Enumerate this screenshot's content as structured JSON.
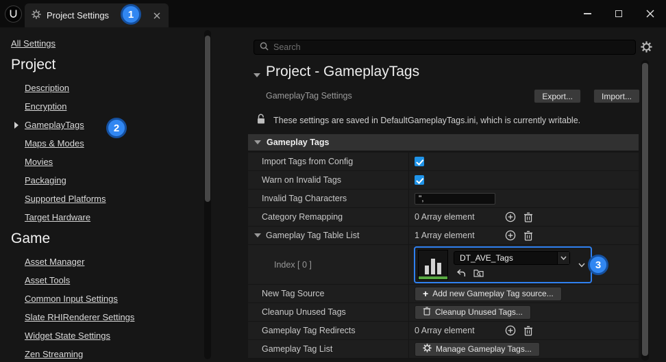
{
  "window": {
    "tab_title": "Project Settings"
  },
  "annotations": {
    "one": "1",
    "two": "2",
    "three": "3"
  },
  "sidebar": {
    "all_settings": "All Settings",
    "selected": "GameplayTags",
    "sections": [
      {
        "title": "Project",
        "items": [
          "Description",
          "Encryption",
          "GameplayTags",
          "Maps & Modes",
          "Movies",
          "Packaging",
          "Supported Platforms",
          "Target Hardware"
        ]
      },
      {
        "title": "Game",
        "items": [
          "Asset Manager",
          "Asset Tools",
          "Common Input Settings",
          "Slate RHIRenderer Settings",
          "Widget State Settings",
          "Zen Streaming"
        ]
      }
    ]
  },
  "search": {
    "placeholder": "Search"
  },
  "page": {
    "title": "Project - GameplayTags",
    "subtitle": "GameplayTag Settings",
    "export_button": "Export...",
    "import_button": "Import...",
    "notice": "These settings are saved in DefaultGameplayTags.ini, which is currently writable."
  },
  "section": {
    "title": "Gameplay Tags"
  },
  "rows": {
    "import_tags_from_config": {
      "label": "Import Tags from Config",
      "checked": true
    },
    "warn_on_invalid_tags": {
      "label": "Warn on Invalid Tags",
      "checked": true
    },
    "invalid_tag_characters": {
      "label": "Invalid Tag Characters",
      "value": "\","
    },
    "category_remapping": {
      "label": "Category Remapping",
      "value": "0 Array element"
    },
    "gameplay_tag_table_list": {
      "label": "Gameplay Tag Table List",
      "value": "1 Array element"
    },
    "index_0": {
      "label": "Index [ 0 ]",
      "asset_name": "DT_AVE_Tags"
    },
    "new_tag_source": {
      "label": "New Tag Source",
      "button_prefix": "+",
      "button": "Add new Gameplay Tag source..."
    },
    "cleanup_unused_tags": {
      "label": "Cleanup Unused Tags",
      "button": "Cleanup Unused Tags..."
    },
    "gameplay_tag_redirects": {
      "label": "Gameplay Tag Redirects",
      "value": "0 Array element"
    },
    "gameplay_tag_list": {
      "label": "Gameplay Tag List",
      "button": "Manage Gameplay Tags..."
    }
  },
  "colors": {
    "annotation_blue": "#3187f2",
    "checkbox_blue": "#1f93e8",
    "datatable_green": "#58a942"
  },
  "icons": {
    "tab": "gear-icon",
    "search": "magnifier-icon",
    "notice": "unlock-icon",
    "array_add": "plus-circle-icon",
    "array_delete": "trash-icon",
    "asset_use": "use-selected-arrow-icon",
    "asset_browse": "browse-folder-icon"
  }
}
